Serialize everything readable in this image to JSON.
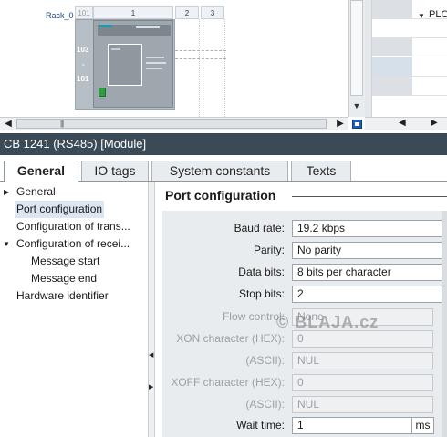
{
  "device_view": {
    "rack_label": "Rack_0",
    "slot_headers": [
      "101",
      "1",
      "2",
      "3"
    ],
    "address_labels": [
      "103",
      "-",
      "101"
    ]
  },
  "right_pane": {
    "plc_label": "PLC"
  },
  "scroll": {
    "grip": "|||"
  },
  "inspector": {
    "title": "CB 1241 (RS485) [Module]",
    "tabs": [
      "General",
      "IO tags",
      "System constants",
      "Texts"
    ],
    "active_tab": "General"
  },
  "tree": {
    "items": [
      {
        "label": "General",
        "arrow": "▶"
      },
      {
        "label": "Port configuration",
        "arrow": ""
      },
      {
        "label": "Configuration of trans...",
        "arrow": ""
      },
      {
        "label": "Configuration of recei...",
        "arrow": "▼"
      },
      {
        "label": "Message start",
        "arrow": ""
      },
      {
        "label": "Message end",
        "arrow": ""
      },
      {
        "label": "Hardware identifier",
        "arrow": ""
      }
    ],
    "selected": "Port configuration"
  },
  "section": {
    "title": "Port configuration"
  },
  "form": {
    "baud_rate": {
      "label": "Baud rate:",
      "value": "19.2 kbps"
    },
    "parity": {
      "label": "Parity:",
      "value": "No parity"
    },
    "data_bits": {
      "label": "Data bits:",
      "value": "8 bits per character"
    },
    "stop_bits": {
      "label": "Stop bits:",
      "value": "2"
    },
    "flow_control": {
      "label": "Flow control:",
      "value": "None"
    },
    "xon_hex": {
      "label": "XON character (HEX):",
      "value": "0"
    },
    "xon_ascii": {
      "label": "(ASCII):",
      "value": "NUL"
    },
    "xoff_hex": {
      "label": "XOFF character (HEX):",
      "value": "0"
    },
    "xoff_ascii": {
      "label": "(ASCII):",
      "value": "NUL"
    },
    "wait_time": {
      "label": "Wait time:",
      "value": "1",
      "unit": "ms"
    }
  },
  "watermark": "© BLAJA.cz",
  "colors": {
    "titlebar": "#3b4a57",
    "selection": "#dce6f0",
    "form_bg": "#e9ecef"
  }
}
